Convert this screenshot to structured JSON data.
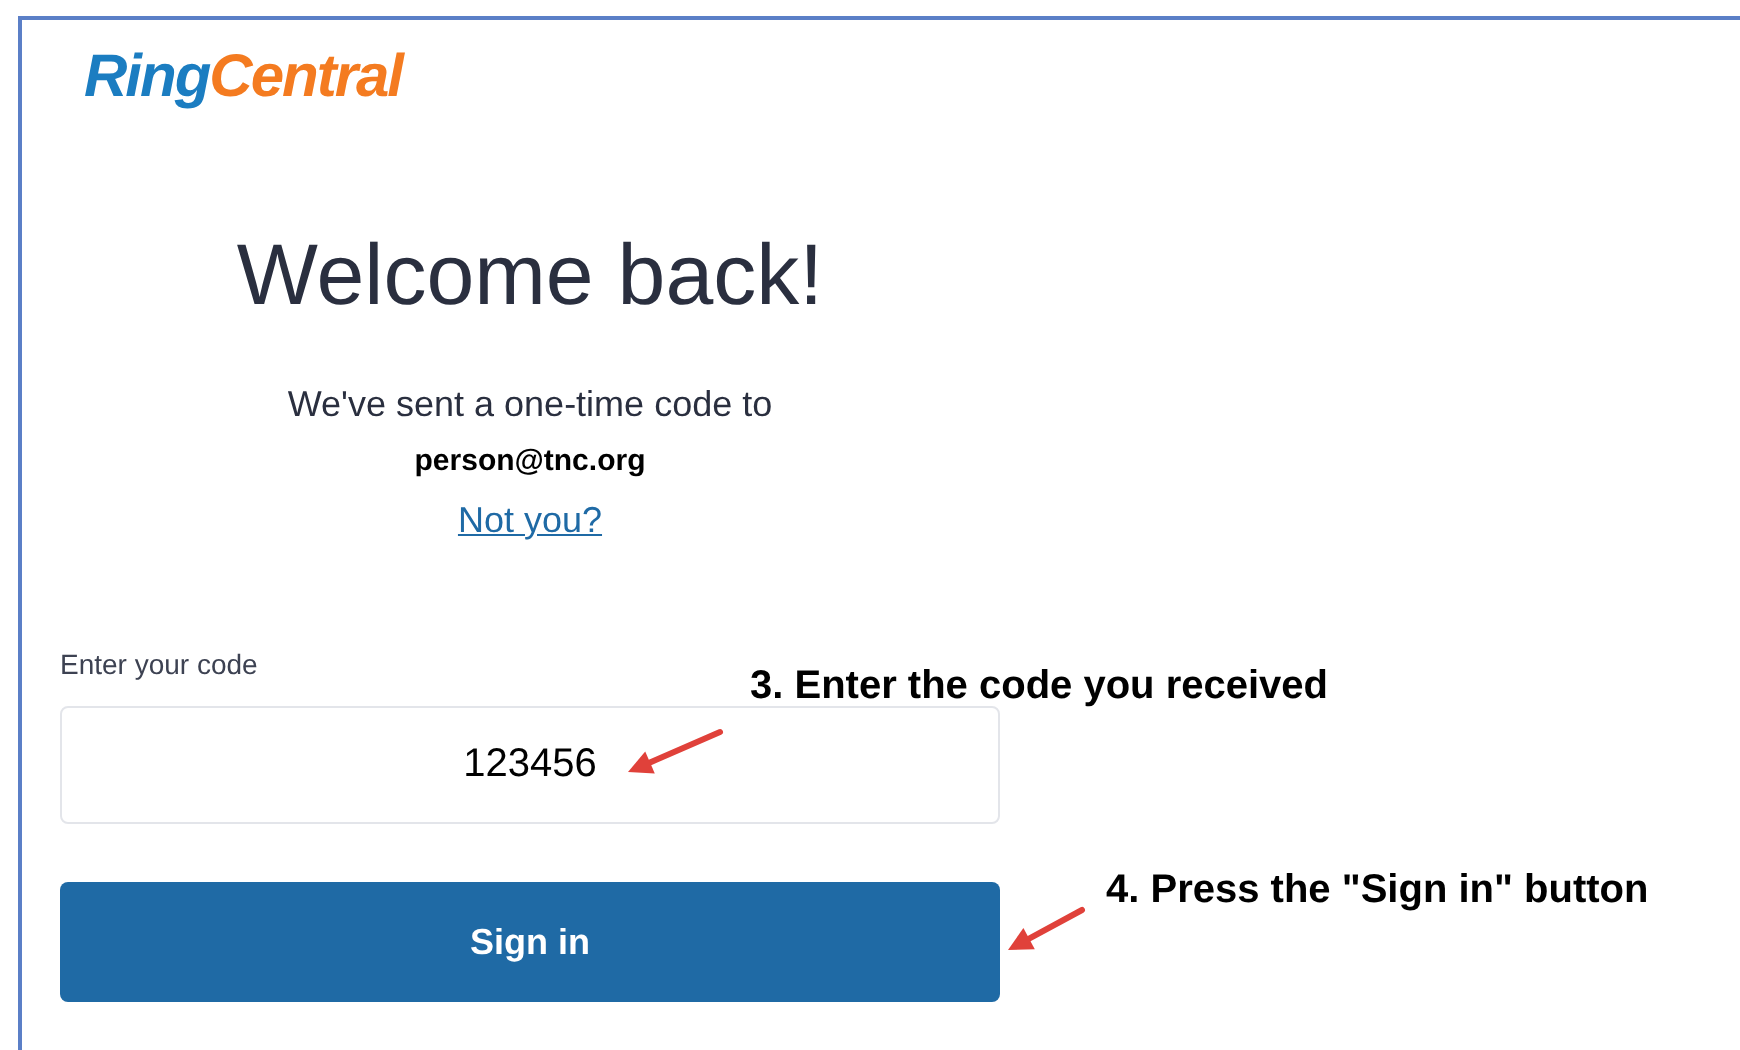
{
  "logo": {
    "part_1": "Ring",
    "part_2": "Central"
  },
  "heading": "Welcome back!",
  "message": "We've sent a one-time code to",
  "email": "person@tnc.org",
  "link": "Not you?",
  "code_field": {
    "label": "Enter your code",
    "value": "123456"
  },
  "button": "Sign in",
  "annotations": [
    {
      "text": "3. Enter the code you received"
    },
    {
      "text": "4. Press the \"Sign in\" button"
    }
  ]
}
